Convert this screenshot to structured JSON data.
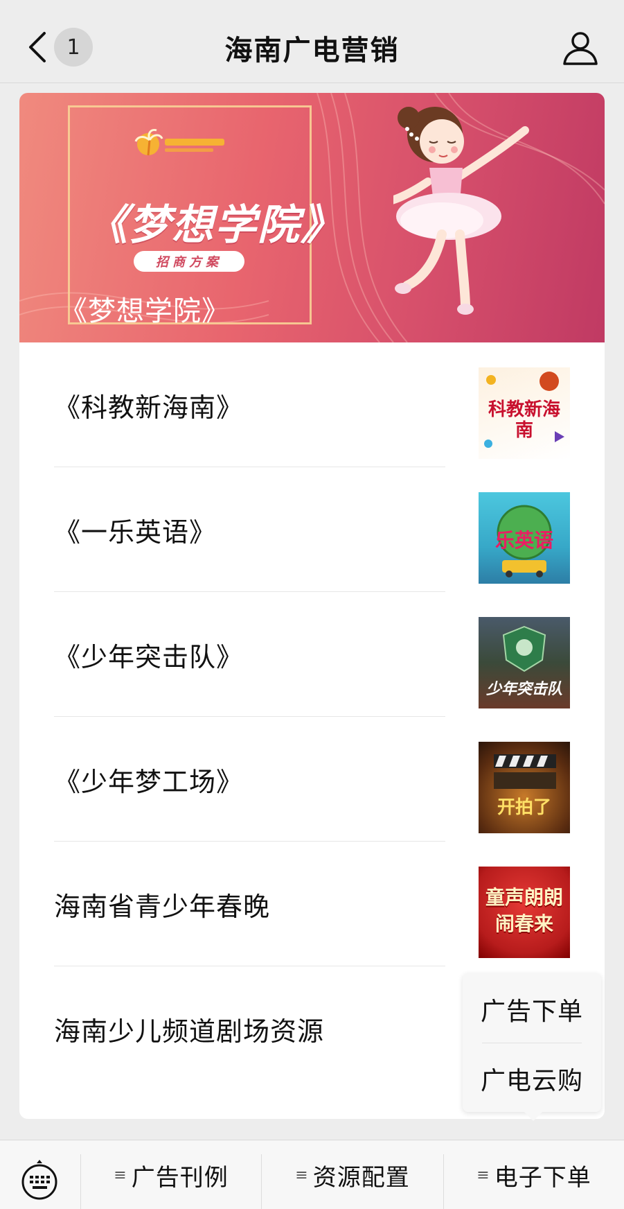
{
  "header": {
    "title": "海南广电营销",
    "back_count": "1",
    "back_icon": "chevron-left-icon",
    "profile_icon": "person-icon"
  },
  "banner": {
    "heading": "《梦想学院》",
    "tag": "招商方案",
    "caption": "《梦想学院》",
    "accent": "#e8656e"
  },
  "list": {
    "items": [
      {
        "label": "《科教新海南》",
        "thumb_text": "科教新海南"
      },
      {
        "label": "《一乐英语》",
        "thumb_text": "乐英语"
      },
      {
        "label": "《少年突击队》",
        "thumb_text": "少年突击队"
      },
      {
        "label": "《少年梦工场》",
        "thumb_text": "开拍了"
      },
      {
        "label": "海南省青少年春晚",
        "thumb_text": "童声朗朗闹春来"
      },
      {
        "label": "海南少儿频道剧场资源"
      }
    ]
  },
  "popup": {
    "items": [
      "广告下单",
      "广电云购"
    ]
  },
  "bottom_menu": {
    "items": [
      "广告刊例",
      "资源配置",
      "电子下单"
    ],
    "keyboard_icon": "keyboard-icon"
  }
}
